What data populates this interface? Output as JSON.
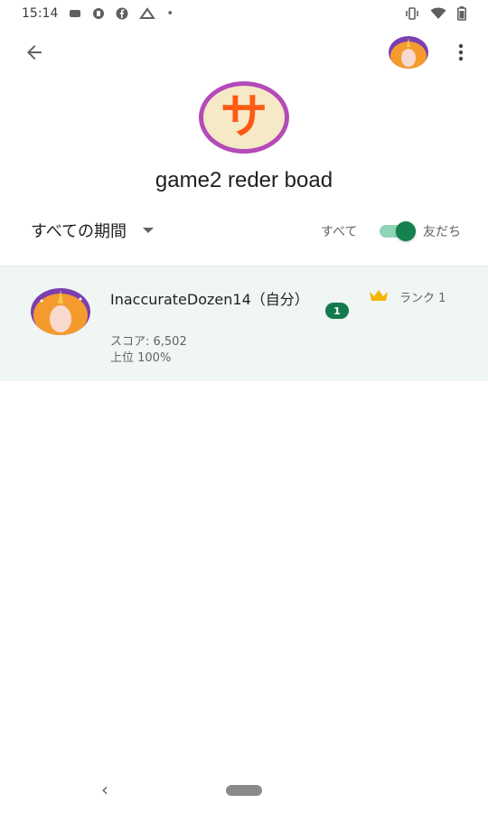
{
  "status_bar": {
    "time": "15:14",
    "notification_icons": [
      "notification-icon",
      "notification-icon",
      "facebook-icon",
      "notification-icon"
    ],
    "dot": "•",
    "system_icons": [
      "vibrate-icon",
      "wifi-icon",
      "battery-icon"
    ]
  },
  "app_bar": {
    "back_icon": "arrow-back-icon",
    "overflow_icon": "more-vert-icon"
  },
  "game": {
    "icon_glyph": "サ",
    "icon_colors": {
      "background": "#f5e9c6",
      "ring": "#b34bb8",
      "glyph": "#ff5a14"
    },
    "title": "game2 reder boad"
  },
  "filters": {
    "period_label": "すべての期間",
    "scope_all_label": "すべて",
    "scope_friends_label": "友だち",
    "friends_toggle_on": true,
    "accent_color": "#13824d"
  },
  "leaderboard": {
    "entries": [
      {
        "name": "InaccurateDozen14（自分）",
        "score": "スコア: 6,502",
        "percentile": "上位 100%",
        "rank_badge": "1",
        "rank_label": "ランク 1",
        "rank_icon": "crown-icon"
      }
    ]
  },
  "nav_bar": {
    "back_glyph": "‹"
  }
}
